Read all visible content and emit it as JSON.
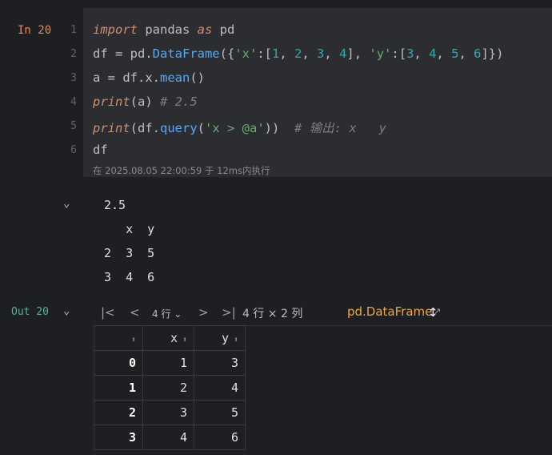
{
  "cell": {
    "prompt_in": "In 20",
    "line_numbers": [
      "1",
      "2",
      "3",
      "4",
      "5",
      "6"
    ],
    "exec_info": "在 2025.08.05 22:00:59 于 12ms内执行"
  },
  "code": {
    "l1_import": "import",
    "l1_pandas": " pandas ",
    "l1_as": "as",
    "l1_pd": " pd",
    "l2_a": "df = pd.",
    "l2_fn": "DataFrame",
    "l2_b": "({",
    "l2_k1": "'x'",
    "l2_c": ":[",
    "l2_v1": "1",
    "l2_s1": ", ",
    "l2_v2": "2",
    "l2_s2": ", ",
    "l2_v3": "3",
    "l2_s3": ", ",
    "l2_v4": "4",
    "l2_d": "], ",
    "l2_k2": "'y'",
    "l2_e": ":[",
    "l2_w1": "3",
    "l2_t1": ", ",
    "l2_w2": "4",
    "l2_t2": ", ",
    "l2_w3": "5",
    "l2_t3": ", ",
    "l2_w4": "6",
    "l2_f": "]})",
    "l3_a": "a = df.x.",
    "l3_fn": "mean",
    "l3_b": "()",
    "l4_fn": "print",
    "l4_b": "(a) ",
    "l4_cmt": "# 2.5",
    "l5_fn": "print",
    "l5_a": "(df.",
    "l5_fn2": "query",
    "l5_b": "(",
    "l5_str": "'x > @a'",
    "l5_c": "))  ",
    "l5_cmt": "# 输出: x   y",
    "l6": "df"
  },
  "stdout": {
    "lines": [
      "2.5",
      "   x  y",
      "2  3  5",
      "3  4  6"
    ]
  },
  "output": {
    "prompt_out": "Out 20",
    "pager_rows": "4 行",
    "row_col_info": "4 行 × 2 列",
    "type_link": "pd.DataFrame",
    "icons": {
      "first": "first-page-icon",
      "prev": "previous-page-icon",
      "next": "next-page-icon",
      "last": "last-page-icon",
      "open": "open-external-icon"
    }
  },
  "table": {
    "columns": [
      "",
      "x",
      "y"
    ],
    "rows": [
      [
        "0",
        "1",
        "3"
      ],
      [
        "1",
        "2",
        "4"
      ],
      [
        "2",
        "3",
        "5"
      ],
      [
        "3",
        "4",
        "6"
      ]
    ]
  }
}
